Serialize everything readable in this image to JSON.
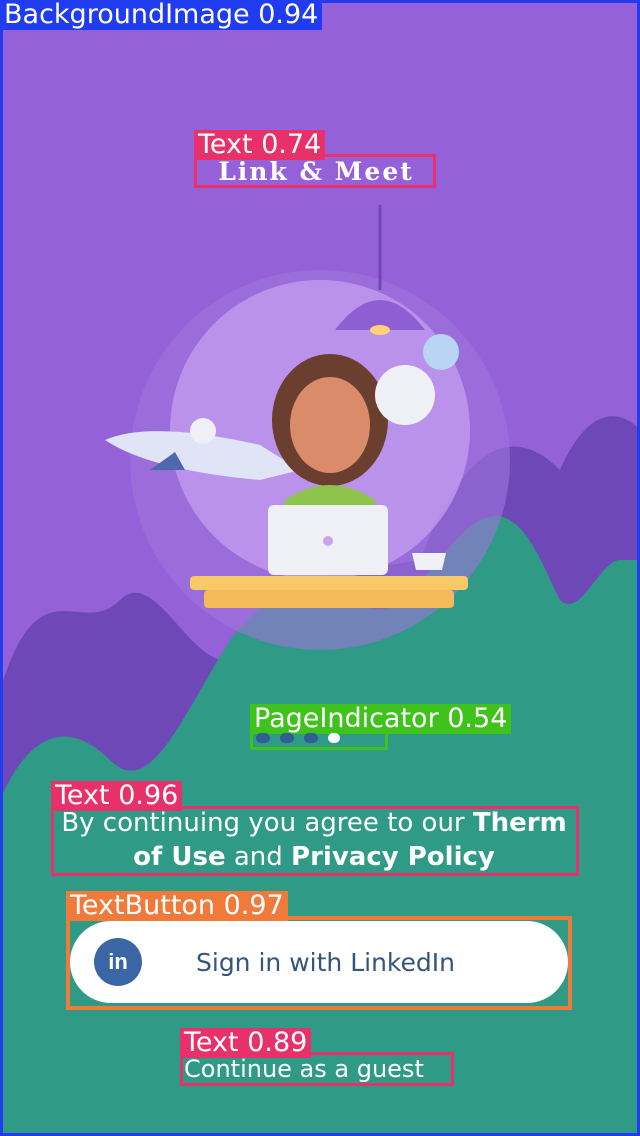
{
  "app": {
    "title": "Link & Meet"
  },
  "pager": {
    "count": 4,
    "active_index": 3
  },
  "terms": {
    "prefix": "By continuing you agree to our ",
    "terms_link": "Therm of Use",
    "middle": " and ",
    "privacy_link": "Privacy Policy"
  },
  "signin": {
    "icon_text": "in",
    "label": "Sign in with LinkedIn"
  },
  "guest": {
    "label": "Continue as a guest"
  },
  "detections": {
    "background": "BackgroundImage 0.94",
    "title": "Text 0.74",
    "pager": "PageIndicator 0.54",
    "terms": "Text 0.96",
    "button": "TextButton 0.97",
    "guest": "Text 0.89"
  },
  "colors": {
    "background_purple": "#9561d8",
    "hill_green": "#2f9a86",
    "box_blue": "#1f3cf0",
    "box_pink": "#e8306a",
    "box_green": "#3fc21b",
    "box_orange": "#f07a3a",
    "linkedin_blue": "#3b66a6"
  }
}
